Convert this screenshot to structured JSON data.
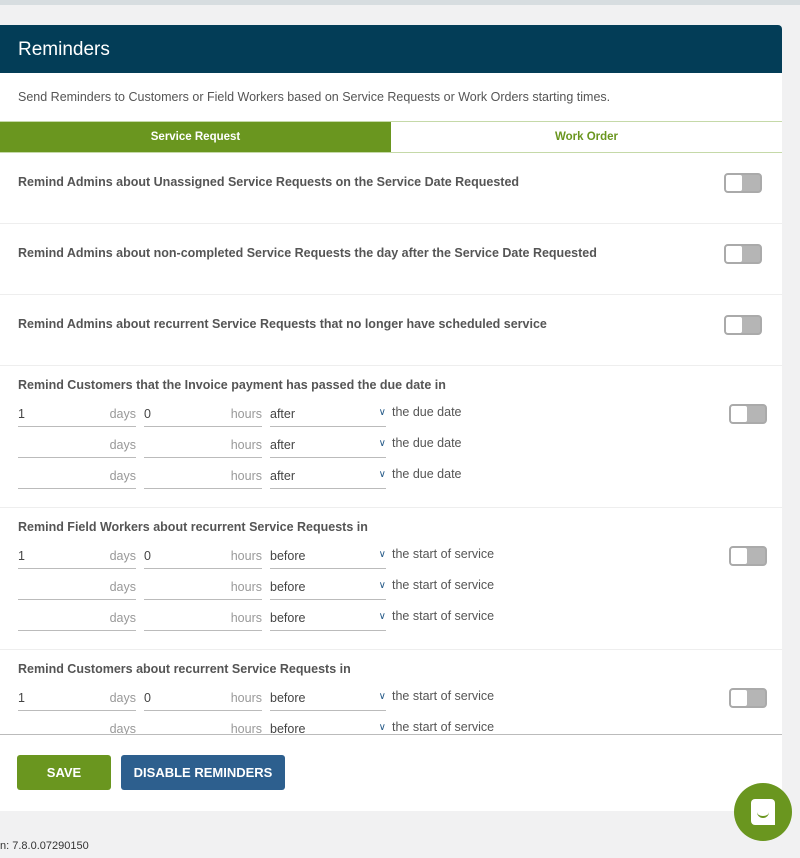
{
  "header": {
    "title": "Reminders"
  },
  "description": "Send Reminders to Customers or Field Workers based on Service Requests or Work Orders starting times.",
  "tabs": [
    {
      "label": "Service Request",
      "active": true
    },
    {
      "label": "Work Order",
      "active": false
    }
  ],
  "simple_rows": [
    {
      "label": "Remind Admins about Unassigned Service Requests on the Service Date Requested",
      "enabled": false
    },
    {
      "label": "Remind Admins about non-completed Service Requests the day after the Service Date Requested",
      "enabled": false
    },
    {
      "label": "Remind Admins about recurrent Service Requests that no longer have scheduled service",
      "enabled": false
    }
  ],
  "units": {
    "days": "days",
    "hours": "hours"
  },
  "groups": [
    {
      "title": "Remind Customers that the Invoice payment has passed the due date in",
      "enabled": false,
      "lines": [
        {
          "days": "1",
          "hours": "0",
          "when": "after",
          "suffix": "the due date"
        },
        {
          "days": "",
          "hours": "",
          "when": "after",
          "suffix": "the due date"
        },
        {
          "days": "",
          "hours": "",
          "when": "after",
          "suffix": "the due date"
        }
      ]
    },
    {
      "title": "Remind Field Workers about recurrent Service Requests in",
      "enabled": false,
      "lines": [
        {
          "days": "1",
          "hours": "0",
          "when": "before",
          "suffix": "the start of service"
        },
        {
          "days": "",
          "hours": "",
          "when": "before",
          "suffix": "the start of service"
        },
        {
          "days": "",
          "hours": "",
          "when": "before",
          "suffix": "the start of service"
        }
      ]
    },
    {
      "title": "Remind Customers about recurrent Service Requests in",
      "enabled": false,
      "lines": [
        {
          "days": "1",
          "hours": "0",
          "when": "before",
          "suffix": "the start of service"
        },
        {
          "days": "",
          "hours": "",
          "when": "before",
          "suffix": "the start of service"
        }
      ]
    }
  ],
  "buttons": {
    "save": "SAVE",
    "disable": "DISABLE REMINDERS"
  },
  "version": "n: 7.8.0.07290150",
  "colors": {
    "header": "#033d57",
    "accent": "#6a961f",
    "secondary": "#2d5f8e"
  }
}
